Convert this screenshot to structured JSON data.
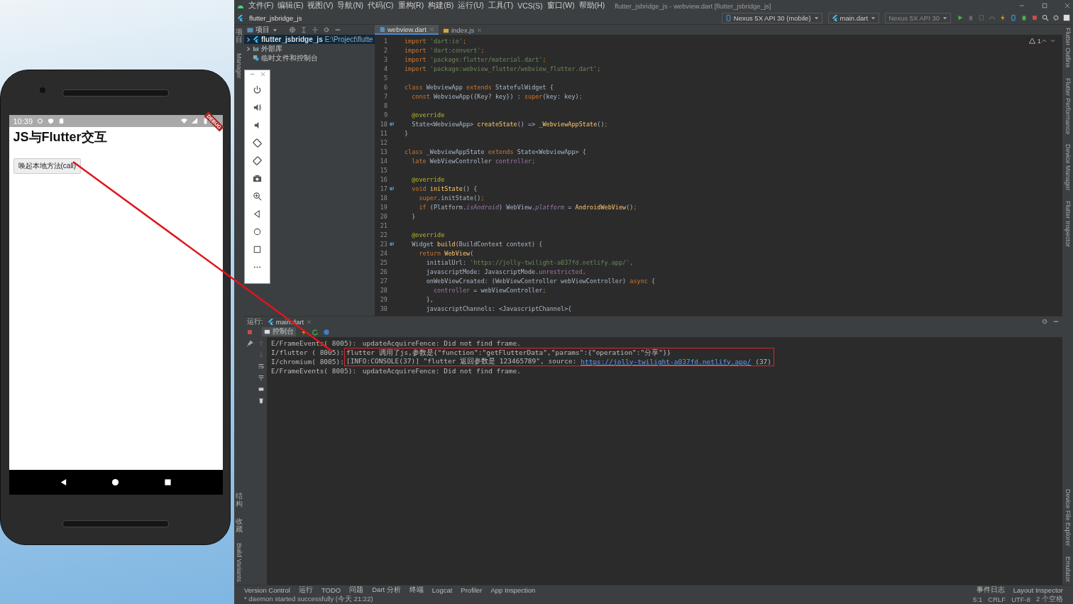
{
  "desktop": {
    "phone": {
      "status_time": "10:39",
      "debug_banner": "DEBUG",
      "app_title": "JS与Flutter交互",
      "button": "唤起本地方法(call)"
    }
  },
  "ide": {
    "menu": [
      "文件(F)",
      "编辑(E)",
      "视图(V)",
      "导航(N)",
      "代码(C)",
      "重构(R)",
      "构建(B)",
      "运行(U)",
      "工具(T)",
      "VCS(S)",
      "窗口(W)",
      "帮助(H)"
    ],
    "window_title": "flutter_jsbridge_js - webview.dart [flutter_jsbridge_js]",
    "project_name": "flutter_jsbridge_js",
    "toolbar": {
      "device": "Nexus 5X API 30 (mobile)",
      "run_config": "main.dart",
      "target": {
        "label": "Nexus 5X API 30",
        "disabled": true
      }
    },
    "project_panel": {
      "title": "项目",
      "tree": [
        {
          "kind": "module",
          "label": "flutter_jsbridge_js",
          "path": "E:\\Project\\flutte",
          "expanded": false,
          "selected": true
        },
        {
          "kind": "library",
          "label": "外部库",
          "expanded": false,
          "selected": false
        },
        {
          "kind": "scratch",
          "label": "临时文件和控制台",
          "selected": false
        }
      ]
    },
    "editor_tabs": [
      {
        "label": "webview.dart",
        "kind": "dart",
        "selected": true
      },
      {
        "label": "index.js",
        "kind": "js",
        "selected": false
      }
    ],
    "inspection_count": "1",
    "code": [
      {
        "number": "1",
        "override": false,
        "tokens": [
          {
            "kind": "kw",
            "text": "import "
          },
          {
            "kind": "str",
            "text": "'dart:io'"
          },
          {
            "kind": "kw",
            "text": ";"
          }
        ]
      },
      {
        "number": "2",
        "override": false,
        "tokens": [
          {
            "kind": "kw",
            "text": "import "
          },
          {
            "kind": "str",
            "text": "'dart:convert'"
          },
          {
            "kind": "kw",
            "text": ";"
          }
        ]
      },
      {
        "number": "3",
        "override": false,
        "tokens": [
          {
            "kind": "kw",
            "text": "import "
          },
          {
            "kind": "str",
            "text": "'package:flutter/material.dart'"
          },
          {
            "kind": "kw",
            "text": ";"
          }
        ]
      },
      {
        "number": "4",
        "override": false,
        "tokens": [
          {
            "kind": "kw",
            "text": "import "
          },
          {
            "kind": "str",
            "text": "'package:webview_flutter/webview_flutter.dart'"
          },
          {
            "kind": "kw",
            "text": ";"
          }
        ]
      },
      {
        "number": "5",
        "override": false
      },
      {
        "number": "6",
        "override": false,
        "tokens": [
          {
            "kind": "kw",
            "text": "class "
          },
          {
            "kind": "plain",
            "text": "WebviewApp "
          },
          {
            "kind": "kw",
            "text": "extends "
          },
          {
            "kind": "plain",
            "text": "StatefulWidget {"
          }
        ]
      },
      {
        "number": "7",
        "override": false,
        "tokens": [
          {
            "kind": "kw",
            "text": "  const "
          },
          {
            "kind": "plain",
            "text": "WebviewApp({Key? key}) : "
          },
          {
            "kind": "kw",
            "text": "super"
          },
          {
            "kind": "plain",
            "text": "(key: key)"
          },
          {
            "kind": "kw",
            "text": ";"
          }
        ]
      },
      {
        "number": "8",
        "override": false
      },
      {
        "number": "9",
        "override": false,
        "tokens": [
          {
            "kind": "ann",
            "text": "  @override"
          }
        ]
      },
      {
        "number": "10",
        "override": true,
        "tokens": [
          {
            "kind": "plain",
            "text": "  State<WebviewApp> "
          },
          {
            "kind": "fn",
            "text": "createState"
          },
          {
            "kind": "plain",
            "text": "() => "
          },
          {
            "kind": "fn",
            "text": "_WebviewAppState"
          },
          {
            "kind": "plain",
            "text": "()"
          },
          {
            "kind": "kw",
            "text": ";"
          }
        ]
      },
      {
        "number": "11",
        "override": false,
        "tokens": [
          {
            "kind": "plain",
            "text": "}"
          }
        ]
      },
      {
        "number": "12",
        "override": false
      },
      {
        "number": "13",
        "override": false,
        "tokens": [
          {
            "kind": "kw",
            "text": "class "
          },
          {
            "kind": "plain",
            "text": "_WebviewAppState "
          },
          {
            "kind": "kw",
            "text": "extends "
          },
          {
            "kind": "plain",
            "text": "State<WebviewApp> {"
          }
        ]
      },
      {
        "number": "14",
        "override": false,
        "tokens": [
          {
            "kind": "kw",
            "text": "  late "
          },
          {
            "kind": "plain",
            "text": "WebViewController "
          },
          {
            "kind": "field",
            "text": "controller"
          },
          {
            "kind": "kw",
            "text": ";"
          }
        ]
      },
      {
        "number": "15",
        "override": false
      },
      {
        "number": "16",
        "override": false,
        "tokens": [
          {
            "kind": "ann",
            "text": "  @override"
          }
        ]
      },
      {
        "number": "17",
        "override": true,
        "tokens": [
          {
            "kind": "kw",
            "text": "  void "
          },
          {
            "kind": "fn",
            "text": "initState"
          },
          {
            "kind": "plain",
            "text": "() {"
          }
        ]
      },
      {
        "number": "18",
        "override": false,
        "tokens": [
          {
            "kind": "kw",
            "text": "    super"
          },
          {
            "kind": "plain",
            "text": ".initState()"
          },
          {
            "kind": "kw",
            "text": ";"
          }
        ]
      },
      {
        "number": "19",
        "override": false,
        "tokens": [
          {
            "kind": "kw",
            "text": "    if "
          },
          {
            "kind": "plain",
            "text": "(Platform."
          },
          {
            "kind": "italic",
            "text": "isAndroid"
          },
          {
            "kind": "plain",
            "text": ") WebView."
          },
          {
            "kind": "italic",
            "text": "platform"
          },
          {
            "kind": "plain",
            "text": " = "
          },
          {
            "kind": "fn",
            "text": "AndroidWebView"
          },
          {
            "kind": "plain",
            "text": "()"
          },
          {
            "kind": "kw",
            "text": ";"
          }
        ]
      },
      {
        "number": "20",
        "override": false,
        "tokens": [
          {
            "kind": "plain",
            "text": "  }"
          }
        ]
      },
      {
        "number": "21",
        "override": false
      },
      {
        "number": "22",
        "override": false,
        "tokens": [
          {
            "kind": "ann",
            "text": "  @override"
          }
        ]
      },
      {
        "number": "23",
        "override": true,
        "tokens": [
          {
            "kind": "plain",
            "text": "  Widget "
          },
          {
            "kind": "fn",
            "text": "build"
          },
          {
            "kind": "plain",
            "text": "(BuildContext context) {"
          }
        ]
      },
      {
        "number": "24",
        "override": false,
        "tokens": [
          {
            "kind": "kw",
            "text": "    return "
          },
          {
            "kind": "fn",
            "text": "WebView"
          },
          {
            "kind": "plain",
            "text": "("
          }
        ]
      },
      {
        "number": "25",
        "override": false,
        "tokens": [
          {
            "kind": "plain",
            "text": "      initialUrl: "
          },
          {
            "kind": "str",
            "text": "'https://jolly-twilight-a037fd.netlify.app/'"
          },
          {
            "kind": "kw",
            "text": ","
          }
        ]
      },
      {
        "number": "26",
        "override": false,
        "tokens": [
          {
            "kind": "plain",
            "text": "      javascriptMode: JavascriptMode."
          },
          {
            "kind": "field",
            "text": "unrestricted"
          },
          {
            "kind": "kw",
            "text": ","
          }
        ]
      },
      {
        "number": "27",
        "override": false,
        "tokens": [
          {
            "kind": "plain",
            "text": "      onWebViewCreated: (WebViewController webViewController) "
          },
          {
            "kind": "kw",
            "text": "async "
          },
          {
            "kind": "plain",
            "text": "{"
          }
        ]
      },
      {
        "number": "28",
        "override": false,
        "tokens": [
          {
            "kind": "field",
            "text": "        controller "
          },
          {
            "kind": "plain",
            "text": "= webViewController"
          },
          {
            "kind": "kw",
            "text": ";"
          }
        ]
      },
      {
        "number": "29",
        "override": false,
        "tokens": [
          {
            "kind": "plain",
            "text": "      },"
          }
        ]
      },
      {
        "number": "30",
        "override": false,
        "tokens": [
          {
            "kind": "plain",
            "text": "      javascriptChannels: <JavascriptChannel>{"
          }
        ]
      }
    ],
    "run": {
      "label": "运行:",
      "tab": "main.dart",
      "console_tab": "控制台",
      "lines": [
        {
          "prefix": "E/FrameEvents( 8005):",
          "message": " updateAcquireFence: Did not find frame.",
          "highlighted": false
        },
        {
          "prefix": "I/flutter ( 8005):",
          "message": "flutter 调用了js,参数是{\"function\":\"getFlutterData\",\"params\":{\"operation\":\"分享\"}}",
          "highlighted": true
        },
        {
          "prefix": "I/chromium( 8005):",
          "message": "[INFO:CONSOLE(37)] \"flutter 返回参数是 123465789\", source: ",
          "link": "https://jolly-twilight-a037fd.netlify.app/",
          "suffix": " (37)",
          "highlighted": true
        },
        {
          "prefix": "E/FrameEvents( 8005):",
          "message": " updateAcquireFence: Did not find frame.",
          "highlighted": false
        }
      ]
    },
    "tool_tabs": [
      "Version Control",
      "运行",
      "TODO",
      "问题",
      "Dart 分析",
      "终端",
      "Logcat",
      "Profiler",
      "App Inspection"
    ],
    "tool_tabs_right": [
      "事件日志",
      "Layout Inspector"
    ],
    "side_labels": {
      "left_top": [
        "项目",
        "Manager"
      ],
      "left_bottom": [
        "结构",
        "收藏",
        "Build Variants"
      ],
      "right_top": [
        "Flutter Outline",
        "Flutter Performance",
        "Device Manager",
        "Flutter Inspector"
      ],
      "right_bottom": [
        "Device File Explorer",
        "Emulator"
      ]
    },
    "status": {
      "message": "* daemon started successfully (今天 21:22)",
      "items": [
        "5:1",
        "CRLF",
        "UTF-8",
        "2 个空格"
      ]
    }
  }
}
